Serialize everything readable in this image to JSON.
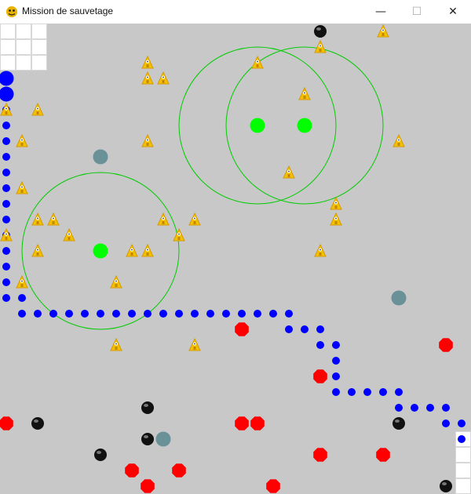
{
  "window": {
    "title": "Mission de sauvetage",
    "minimize_glyph": "—",
    "maximize_glyph": "☐",
    "close_glyph": "✕"
  },
  "icons": {
    "app": "pygame-snake-icon",
    "wounded": "triangle-person-icon"
  },
  "colors": {
    "background": "#c8c8c8",
    "wall": "#ffffff",
    "path": "#0000ff",
    "rescuer": "#00ff00",
    "rescuer_range": "#00cc00",
    "hazard": "#ff0000",
    "obstacle": "#111111",
    "wounded": "#f2c200",
    "marker": "#6a9098"
  }
}
